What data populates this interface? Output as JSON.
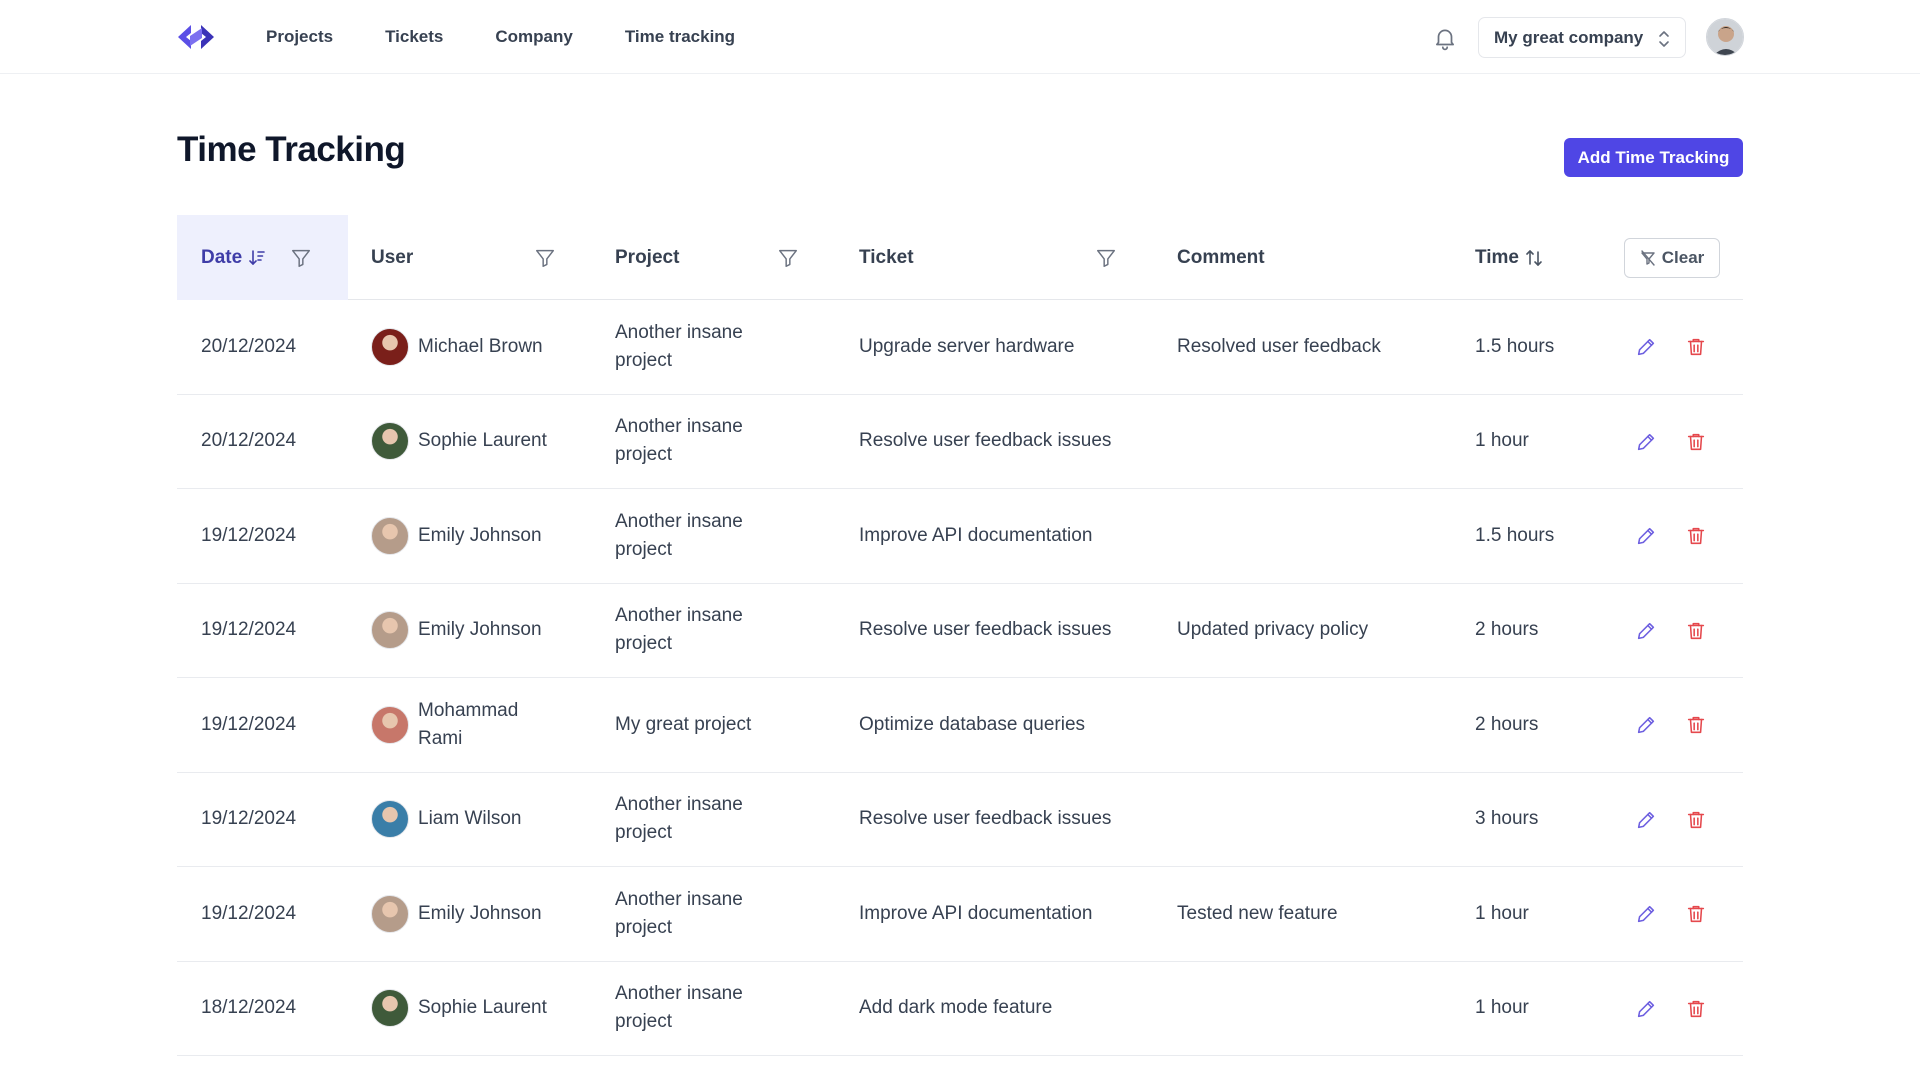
{
  "nav": {
    "items": [
      {
        "label": "Projects"
      },
      {
        "label": "Tickets"
      },
      {
        "label": "Company"
      },
      {
        "label": "Time tracking"
      }
    ],
    "company_select": "My great company"
  },
  "page": {
    "title": "Time Tracking",
    "add_button": "Add Time Tracking"
  },
  "table": {
    "columns": {
      "date": "Date",
      "user": "User",
      "project": "Project",
      "ticket": "Ticket",
      "comment": "Comment",
      "time": "Time"
    },
    "clear_label": "Clear",
    "rows": [
      {
        "date": "20/12/2024",
        "user": "Michael Brown",
        "avatar_color": "#7a1f1a",
        "project": "Another insane project",
        "ticket": "Upgrade server hardware",
        "comment": "Resolved user feedback",
        "time": "1.5 hours"
      },
      {
        "date": "20/12/2024",
        "user": "Sophie Laurent",
        "avatar_color": "#3f5a3a",
        "project": "Another insane project",
        "ticket": "Resolve user feedback issues",
        "comment": "",
        "time": "1 hour"
      },
      {
        "date": "19/12/2024",
        "user": "Emily Johnson",
        "avatar_color": "#b59c8a",
        "project": "Another insane project",
        "ticket": "Improve API documentation",
        "comment": "",
        "time": "1.5 hours"
      },
      {
        "date": "19/12/2024",
        "user": "Emily Johnson",
        "avatar_color": "#b59c8a",
        "project": "Another insane project",
        "ticket": "Resolve user feedback issues",
        "comment": "Updated privacy policy",
        "time": "2 hours"
      },
      {
        "date": "19/12/2024",
        "user": "Mohammad Rami",
        "avatar_color": "#c7776a",
        "project": "My great project",
        "ticket": "Optimize database queries",
        "comment": "",
        "time": "2 hours"
      },
      {
        "date": "19/12/2024",
        "user": "Liam Wilson",
        "avatar_color": "#3a7ea8",
        "project": "Another insane project",
        "ticket": "Resolve user feedback issues",
        "comment": "",
        "time": "3 hours"
      },
      {
        "date": "19/12/2024",
        "user": "Emily Johnson",
        "avatar_color": "#b59c8a",
        "project": "Another insane project",
        "ticket": "Improve API documentation",
        "comment": "Tested new feature",
        "time": "1 hour"
      },
      {
        "date": "18/12/2024",
        "user": "Sophie Laurent",
        "avatar_color": "#3f5a3a",
        "project": "Another insane project",
        "ticket": "Add dark mode feature",
        "comment": "",
        "time": "1 hour"
      }
    ]
  },
  "colors": {
    "accent": "#4f46e5",
    "edit_icon": "#6d5fe0",
    "delete_icon": "#e5484d",
    "header_highlight": "#eef0fd"
  },
  "icons": {
    "logo": "code-brackets-logo",
    "notification": "bell-icon",
    "select": "chevron-updown-icon",
    "filter": "filter-icon",
    "sort": "sort-icon",
    "edit": "pencil-icon",
    "delete": "trash-icon"
  }
}
